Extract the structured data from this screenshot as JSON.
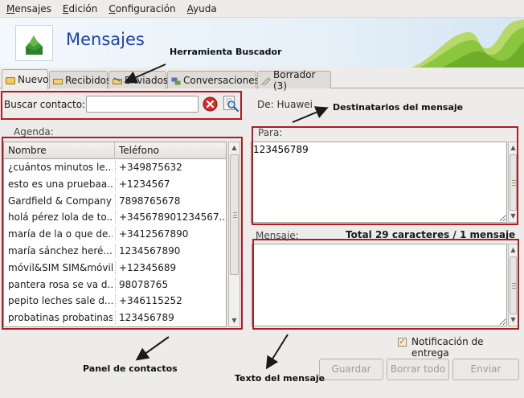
{
  "menubar": {
    "items": [
      "Mensajes",
      "Edición",
      "Configuración",
      "Ayuda"
    ]
  },
  "header": {
    "title": "Mensajes"
  },
  "tabs": [
    {
      "label": "Nuevo",
      "icon": "new-message-icon",
      "active": true
    },
    {
      "label": "Recibidos",
      "icon": "inbox-icon",
      "active": false
    },
    {
      "label": "Enviados",
      "icon": "sent-icon",
      "active": false
    },
    {
      "label": "Conversaciones",
      "icon": "conversations-icon",
      "active": false
    },
    {
      "label": "Borrador (3)",
      "icon": "draft-icon",
      "active": false
    }
  ],
  "search": {
    "label": "Buscar contacto:",
    "value": ""
  },
  "from": {
    "label": "De: Huawei"
  },
  "agenda": {
    "label": "Agenda:",
    "columns": [
      "Nombre",
      "Teléfono"
    ],
    "rows": [
      {
        "name": "¿cuántos minutos le...",
        "phone": "+349875632"
      },
      {
        "name": "esto es una pruebaa...",
        "phone": "+1234567"
      },
      {
        "name": "Gardfield & Company",
        "phone": "7898765678"
      },
      {
        "name": "holá pérez lola de to...",
        "phone": "+345678901234567..."
      },
      {
        "name": "maría de la o que de...",
        "phone": "+3412567890"
      },
      {
        "name": "maría sánchez heré...",
        "phone": "1234567890"
      },
      {
        "name": "móvil&SIM SIM&móvil",
        "phone": "+12345689"
      },
      {
        "name": "pantera rosa se va d...",
        "phone": "98078765"
      },
      {
        "name": "pepito leches sale d...",
        "phone": "+346115252"
      },
      {
        "name": "probatinas probatinas",
        "phone": "123456789"
      }
    ]
  },
  "recipients": {
    "label": "Para:",
    "value": "123456789"
  },
  "message": {
    "label": "Mensaje:",
    "counter": "Total 29 caracteres / 1 mensaje",
    "value": ""
  },
  "delivery_notification": {
    "label": "Notificación de entrega",
    "checked": true
  },
  "buttons": {
    "save": "Guardar",
    "clear_all": "Borrar todo",
    "send": "Enviar"
  },
  "annotations": {
    "search_tool": "Herramienta Buscador",
    "recipients": "Destinatarios del mensaje",
    "contacts_panel": "Panel de contactos",
    "message_text": "Texto del mensaje"
  },
  "colors": {
    "annotation_box": "#b01c22",
    "title": "#1d3fb0",
    "brand_green": "#8cc63f"
  }
}
